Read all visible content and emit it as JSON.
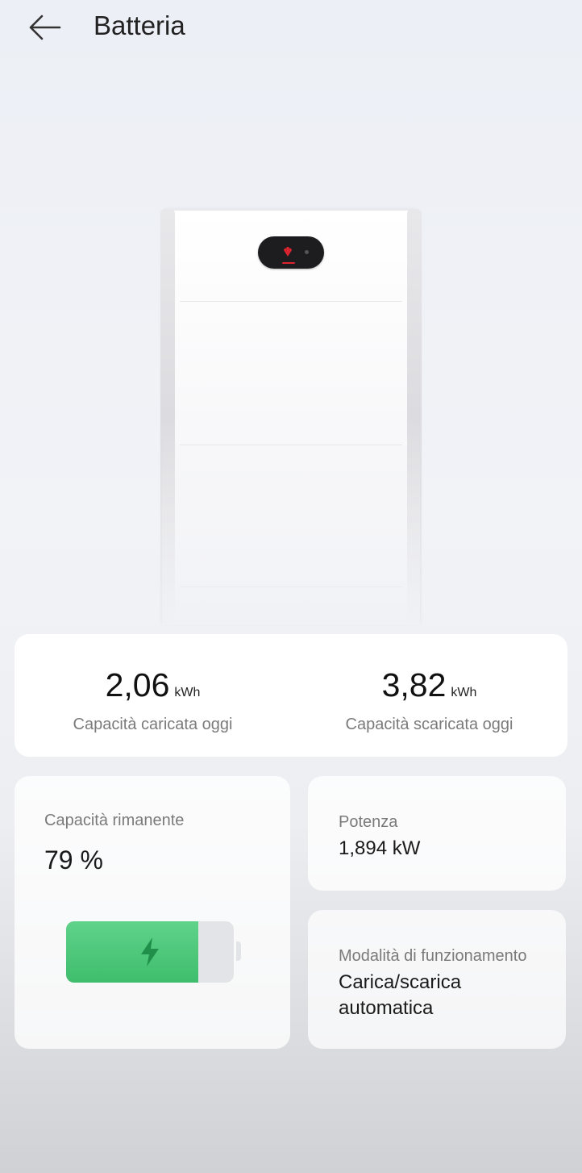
{
  "header": {
    "title": "Batteria",
    "back_icon": "arrow-left-icon"
  },
  "battery_image": {
    "brand_icon": "huawei-logo-icon",
    "display_accent": "#e0242f"
  },
  "today": {
    "charged": {
      "value": "2,06",
      "unit": "kWh",
      "label": "Capacità caricata oggi"
    },
    "discharged": {
      "value": "3,82",
      "unit": "kWh",
      "label": "Capacità scaricata oggi"
    }
  },
  "soc": {
    "label": "Capacità rimanente",
    "value": "79 %",
    "level": 0.79,
    "fill_color": "#4cc577",
    "icon": "lightning-bolt-icon"
  },
  "power": {
    "label": "Potenza",
    "value": "1,894 kW"
  },
  "mode": {
    "label": "Modalità di funzionamento",
    "value_line1": "Carica/scarica",
    "value_line2": "automatica"
  }
}
